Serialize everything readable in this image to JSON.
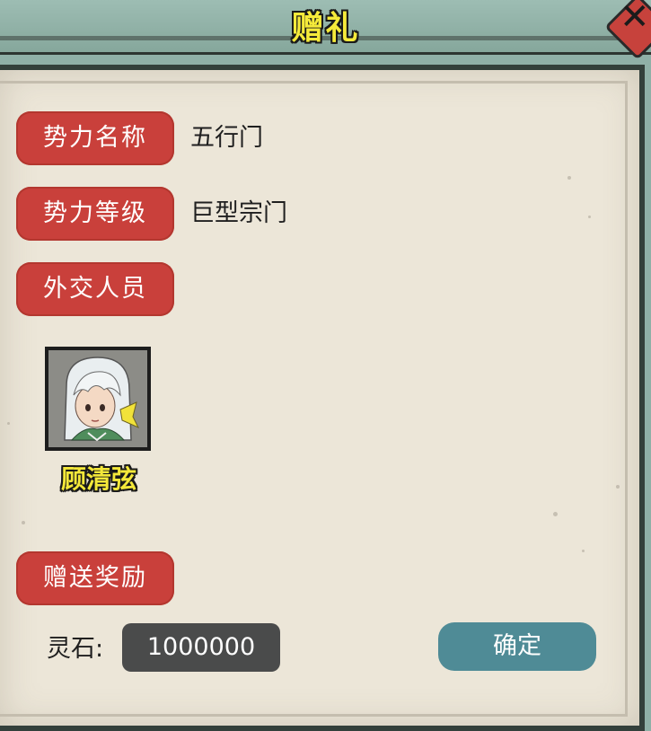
{
  "window": {
    "title": "赠礼"
  },
  "info": {
    "faction_name_label": "势力名称",
    "faction_name_value": "五行门",
    "faction_level_label": "势力等级",
    "faction_level_value": "巨型宗门",
    "diplomat_label": "外交人员"
  },
  "diplomat": {
    "name": "顾清弦"
  },
  "gift": {
    "section_label": "赠送奖励",
    "stone_label": "灵石:",
    "stone_amount": "1000000",
    "confirm_label": "确定"
  },
  "colors": {
    "tag_red": "#c9403b",
    "confirm_teal": "#4f8b96",
    "name_yellow": "#f4e83a",
    "frame_teal": "#8fb0a7"
  },
  "icons": {
    "close": "close-icon"
  }
}
